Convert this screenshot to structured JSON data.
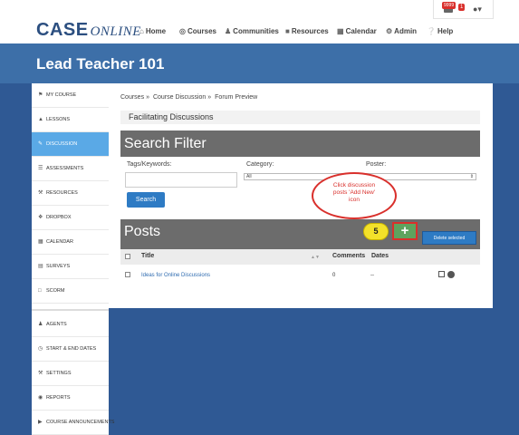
{
  "header": {
    "logo_brand": "CASE",
    "logo_sub": "ONLINE",
    "notif_badge_1": "9999",
    "notif_badge_2": "1",
    "nav": [
      {
        "label": "Home",
        "icon": "home-icon"
      },
      {
        "label": "Courses",
        "icon": "courses-icon"
      },
      {
        "label": "Communities",
        "icon": "communities-icon"
      },
      {
        "label": "Resources",
        "icon": "folder-icon"
      },
      {
        "label": "Calendar",
        "icon": "calendar-icon"
      },
      {
        "label": "Admin",
        "icon": "gear-icon"
      },
      {
        "label": "Help",
        "icon": "help-icon"
      }
    ]
  },
  "course": {
    "title": "Lead Teacher 101"
  },
  "sidebar": {
    "items": [
      {
        "label": "MY COURSE",
        "icon": "flag-icon"
      },
      {
        "label": "LESSONS",
        "icon": "lessons-icon"
      },
      {
        "label": "DISCUSSION",
        "icon": "discussion-icon"
      },
      {
        "label": "ASSESSMENTS",
        "icon": "list-icon"
      },
      {
        "label": "RESOURCES",
        "icon": "wrench-icon"
      },
      {
        "label": "DROPBOX",
        "icon": "dropbox-icon"
      },
      {
        "label": "CALENDAR",
        "icon": "calendar-icon"
      },
      {
        "label": "SURVEYS",
        "icon": "survey-icon"
      },
      {
        "label": "SCORM",
        "icon": "scorm-icon"
      },
      {
        "label": "AGENTS",
        "icon": "agent-icon"
      },
      {
        "label": "START & END DATES",
        "icon": "clock-icon"
      },
      {
        "label": "SETTINGS",
        "icon": "wrench-icon"
      },
      {
        "label": "REPORTS",
        "icon": "reports-icon"
      },
      {
        "label": "COURSE ANNOUNCEMENTS",
        "icon": "megaphone-icon"
      }
    ]
  },
  "breadcrumb": [
    "Courses",
    "Course Discussion",
    "Forum Preview"
  ],
  "section_title": "Facilitating Discussions",
  "search_filter": {
    "title": "Search Filter",
    "keywords_label": "Tags/Keywords:",
    "category_label": "Category:",
    "category_value": "All",
    "poster_label": "Poster:",
    "search_button": "Search"
  },
  "posts": {
    "title": "Posts",
    "add_icon_label": "+",
    "delete_button": "Delete selected",
    "columns": [
      "Title",
      "Comments",
      "Dates"
    ],
    "rows": [
      {
        "title": "Ideas for Online Discussions",
        "comments": "0",
        "dates": "--"
      }
    ]
  },
  "annotation": {
    "callout": "Click discussion posts 'Add New' icon",
    "step": "5"
  },
  "colors": {
    "brand_blue": "#2c4f80",
    "banner": "#3d6fa8",
    "active": "#5aa9e6",
    "button": "#2e7bc4",
    "header_gray": "#6c6c6c"
  }
}
